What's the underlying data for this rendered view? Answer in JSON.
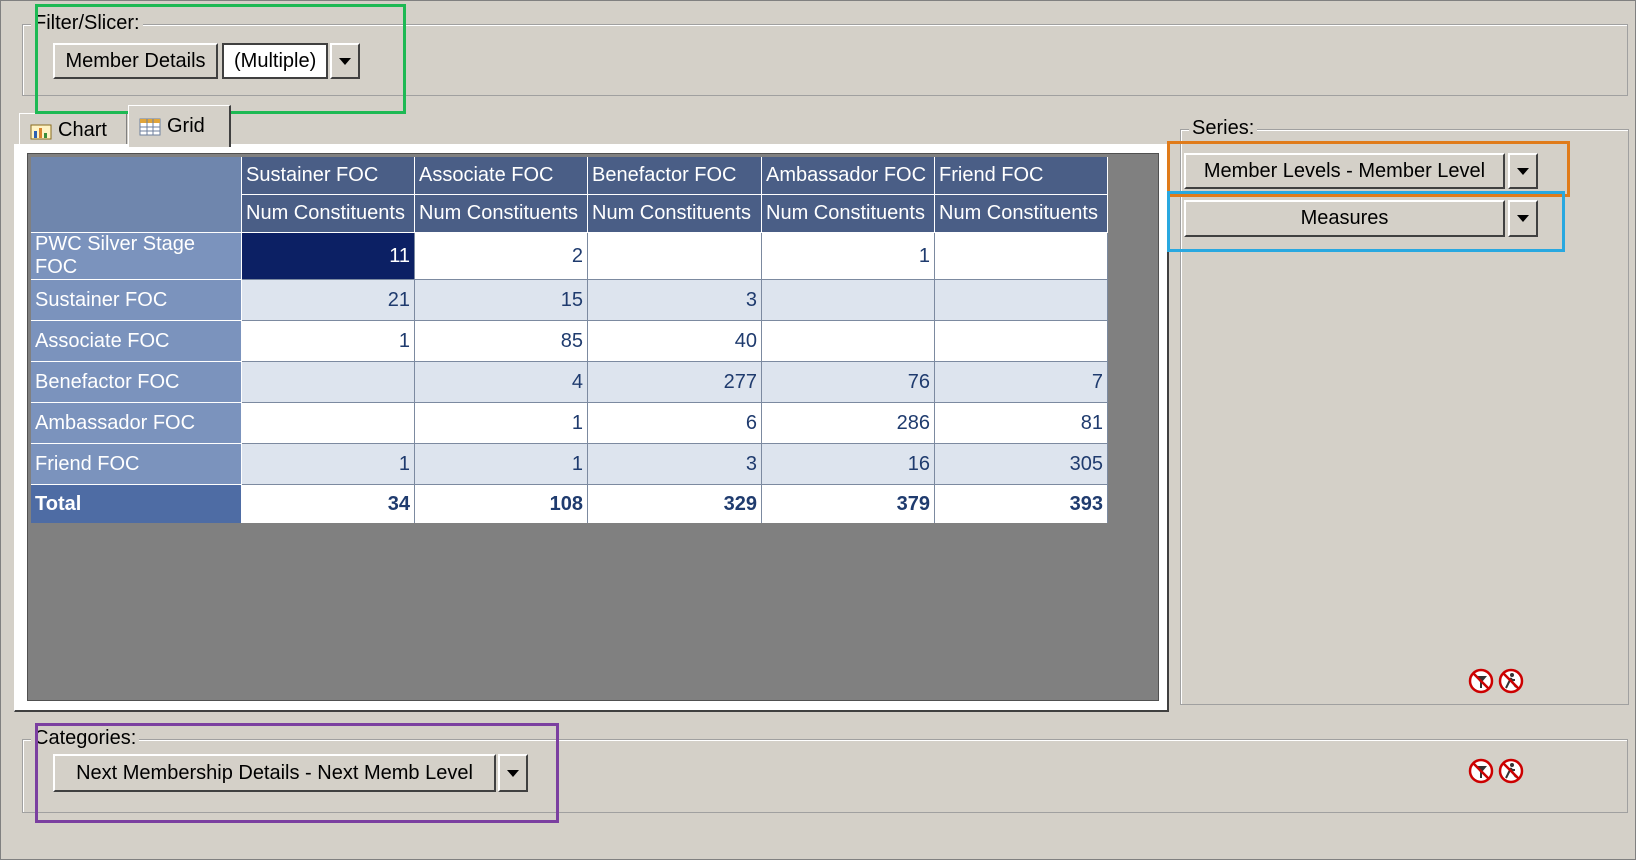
{
  "filter": {
    "legend": "Filter/Slicer:",
    "field_label": "Member Details",
    "field_value": "(Multiple)"
  },
  "tabs": [
    {
      "label": "Chart",
      "active": false
    },
    {
      "label": "Grid",
      "active": true
    }
  ],
  "grid": {
    "column_headers": [
      "Sustainer FOC",
      "Associate FOC",
      "Benefactor FOC",
      "Ambassador FOC",
      "Friend FOC"
    ],
    "measure_headers": [
      "Num Constituents",
      "Num Constituents",
      "Num Constituents",
      "Num Constituents",
      "Num Constituents"
    ],
    "rows": [
      {
        "label": "PWC Silver Stage FOC",
        "values": [
          "11",
          "2",
          "",
          "1",
          ""
        ]
      },
      {
        "label": "Sustainer FOC",
        "values": [
          "21",
          "15",
          "3",
          "",
          ""
        ]
      },
      {
        "label": "Associate FOC",
        "values": [
          "1",
          "85",
          "40",
          "",
          ""
        ]
      },
      {
        "label": "Benefactor FOC",
        "values": [
          "",
          "4",
          "277",
          "76",
          "7"
        ]
      },
      {
        "label": "Ambassador FOC",
        "values": [
          "",
          "1",
          "6",
          "286",
          "81"
        ]
      },
      {
        "label": "Friend FOC",
        "values": [
          "1",
          "1",
          "3",
          "16",
          "305"
        ]
      }
    ],
    "total": {
      "label": "Total",
      "values": [
        "34",
        "108",
        "329",
        "379",
        "393"
      ]
    },
    "selected_cell": "PWC Silver Stage FOC / Sustainer FOC"
  },
  "series": {
    "legend": "Series:",
    "items": [
      "Member Levels - Member Level",
      "Measures"
    ]
  },
  "categories": {
    "legend": "Categories:",
    "items": [
      "Next Membership Details - Next Memb Level"
    ]
  },
  "highlight_colors": {
    "filter": "#1db954",
    "series_primary": "#e07b1a",
    "series_measures": "#29a8e0",
    "categories": "#7b3fa0"
  }
}
